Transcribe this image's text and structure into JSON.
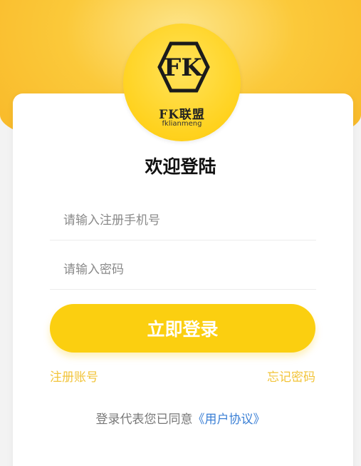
{
  "brand": {
    "logo_text": "FK",
    "name": "FK联盟",
    "subname": "fklianmeng"
  },
  "login": {
    "title": "欢迎登陆",
    "phone_placeholder": "请输入注册手机号",
    "password_placeholder": "请输入密码",
    "submit_label": "立即登录",
    "register_link": "注册账号",
    "forgot_link": "忘记密码",
    "agreement_prefix": "登录代表您已同意",
    "agreement_link": "《用户协议》"
  },
  "colors": {
    "accent": "#fbcf10",
    "link_yellow": "#f2c43a",
    "link_blue": "#3a7fd5"
  }
}
